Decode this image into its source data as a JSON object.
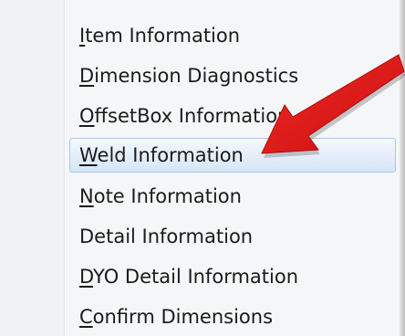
{
  "menu": {
    "items": [
      {
        "accel": "I",
        "rest": "tem Information",
        "highlighted": false
      },
      {
        "accel": "D",
        "rest": "imension Diagnostics",
        "highlighted": false
      },
      {
        "accel": "O",
        "rest": "ffsetBox Information",
        "highlighted": false
      },
      {
        "accel": "W",
        "rest": "eld Information",
        "highlighted": true
      },
      {
        "accel": "N",
        "rest": "ote Information",
        "highlighted": false
      },
      {
        "accel": "",
        "rest": "Detail Information",
        "highlighted": false
      },
      {
        "accel": "D",
        "rest": "YO Detail Information",
        "highlighted": false
      },
      {
        "accel": "C",
        "rest": "onfirm Dimensions",
        "highlighted": false
      }
    ]
  },
  "annotation": {
    "arrow_color": "#e3191b",
    "highlight_color": "#dbe8f8"
  }
}
